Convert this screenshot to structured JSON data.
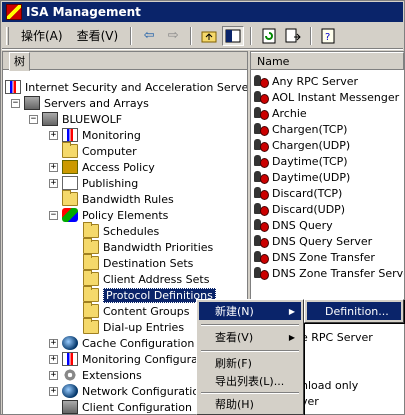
{
  "window": {
    "title": "ISA Management"
  },
  "menubar": {
    "action_label": "操作(A)",
    "view_label": "查看(V)"
  },
  "toolbar": {
    "buttons": [
      "back-arrow-icon",
      "forward-arrow-icon",
      "up-folder-icon",
      "show-hide-tree-icon",
      "refresh-icon",
      "export-icon",
      "help-icon"
    ]
  },
  "tree": {
    "tab_label": "树",
    "items": [
      {
        "label": "Internet Security and Acceleration Server"
      },
      {
        "label": "Servers and Arrays"
      },
      {
        "label": "BLUEWOLF"
      },
      {
        "label": "Monitoring"
      },
      {
        "label": "Computer"
      },
      {
        "label": "Access Policy"
      },
      {
        "label": "Publishing"
      },
      {
        "label": "Bandwidth Rules"
      },
      {
        "label": "Policy Elements"
      },
      {
        "label": "Schedules"
      },
      {
        "label": "Bandwidth Priorities"
      },
      {
        "label": "Destination Sets"
      },
      {
        "label": "Client Address Sets"
      },
      {
        "label": "Protocol Definitions"
      },
      {
        "label": "Content Groups"
      },
      {
        "label": "Dial-up Entries"
      },
      {
        "label": "Cache Configuration"
      },
      {
        "label": "Monitoring Configuration"
      },
      {
        "label": "Extensions"
      },
      {
        "label": "Network Configuration"
      },
      {
        "label": "Client Configuration"
      }
    ]
  },
  "list": {
    "column_header": "Name",
    "items": [
      "Any RPC Server",
      "AOL Instant Messenger",
      "Archie",
      "Chargen(TCP)",
      "Chargen(UDP)",
      "Daytime(TCP)",
      "Daytime(UDP)",
      "Discard(TCP)",
      "Discard(UDP)",
      "DNS Query",
      "DNS Query Server",
      "DNS Zone Transfer",
      "DNS Zone Transfer Server"
    ],
    "partial_items": [
      "e RPC Server",
      "nload only",
      "ver"
    ]
  },
  "context_menu": {
    "items": [
      {
        "label": "新建(N)",
        "has_submenu": true,
        "active": true
      },
      {
        "label": "查看(V)",
        "has_submenu": true
      },
      {
        "label": "刷新(F)"
      },
      {
        "label": "导出列表(L)..."
      },
      {
        "label": "帮助(H)"
      }
    ]
  },
  "submenu": {
    "items": [
      {
        "label": "Definition..."
      }
    ]
  }
}
